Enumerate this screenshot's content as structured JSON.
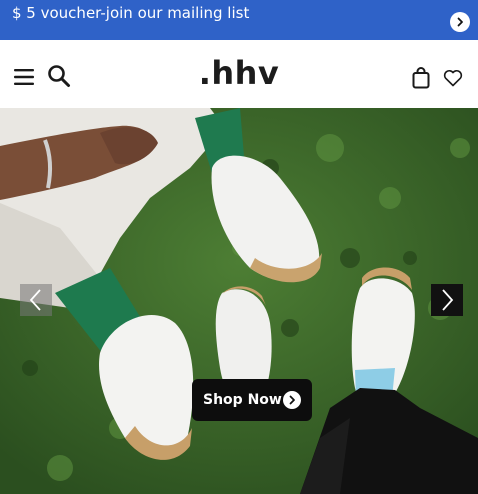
{
  "promo": {
    "text": "$ 5 voucher-join our mailing list",
    "arrow_icon": "chevron-right-icon",
    "background": "#2f62c8"
  },
  "header": {
    "logo": ".hhv",
    "menu_icon": "hamburger-menu-icon",
    "search_icon": "search-icon",
    "bag_icon": "shopping-bag-icon",
    "wishlist_icon": "heart-icon"
  },
  "hero": {
    "image_alt": "Sneakers on grass",
    "cta_label": "Shop Now",
    "cta_icon": "chevron-right-icon",
    "prev_icon": "chevron-left-icon",
    "next_icon": "chevron-right-icon"
  }
}
